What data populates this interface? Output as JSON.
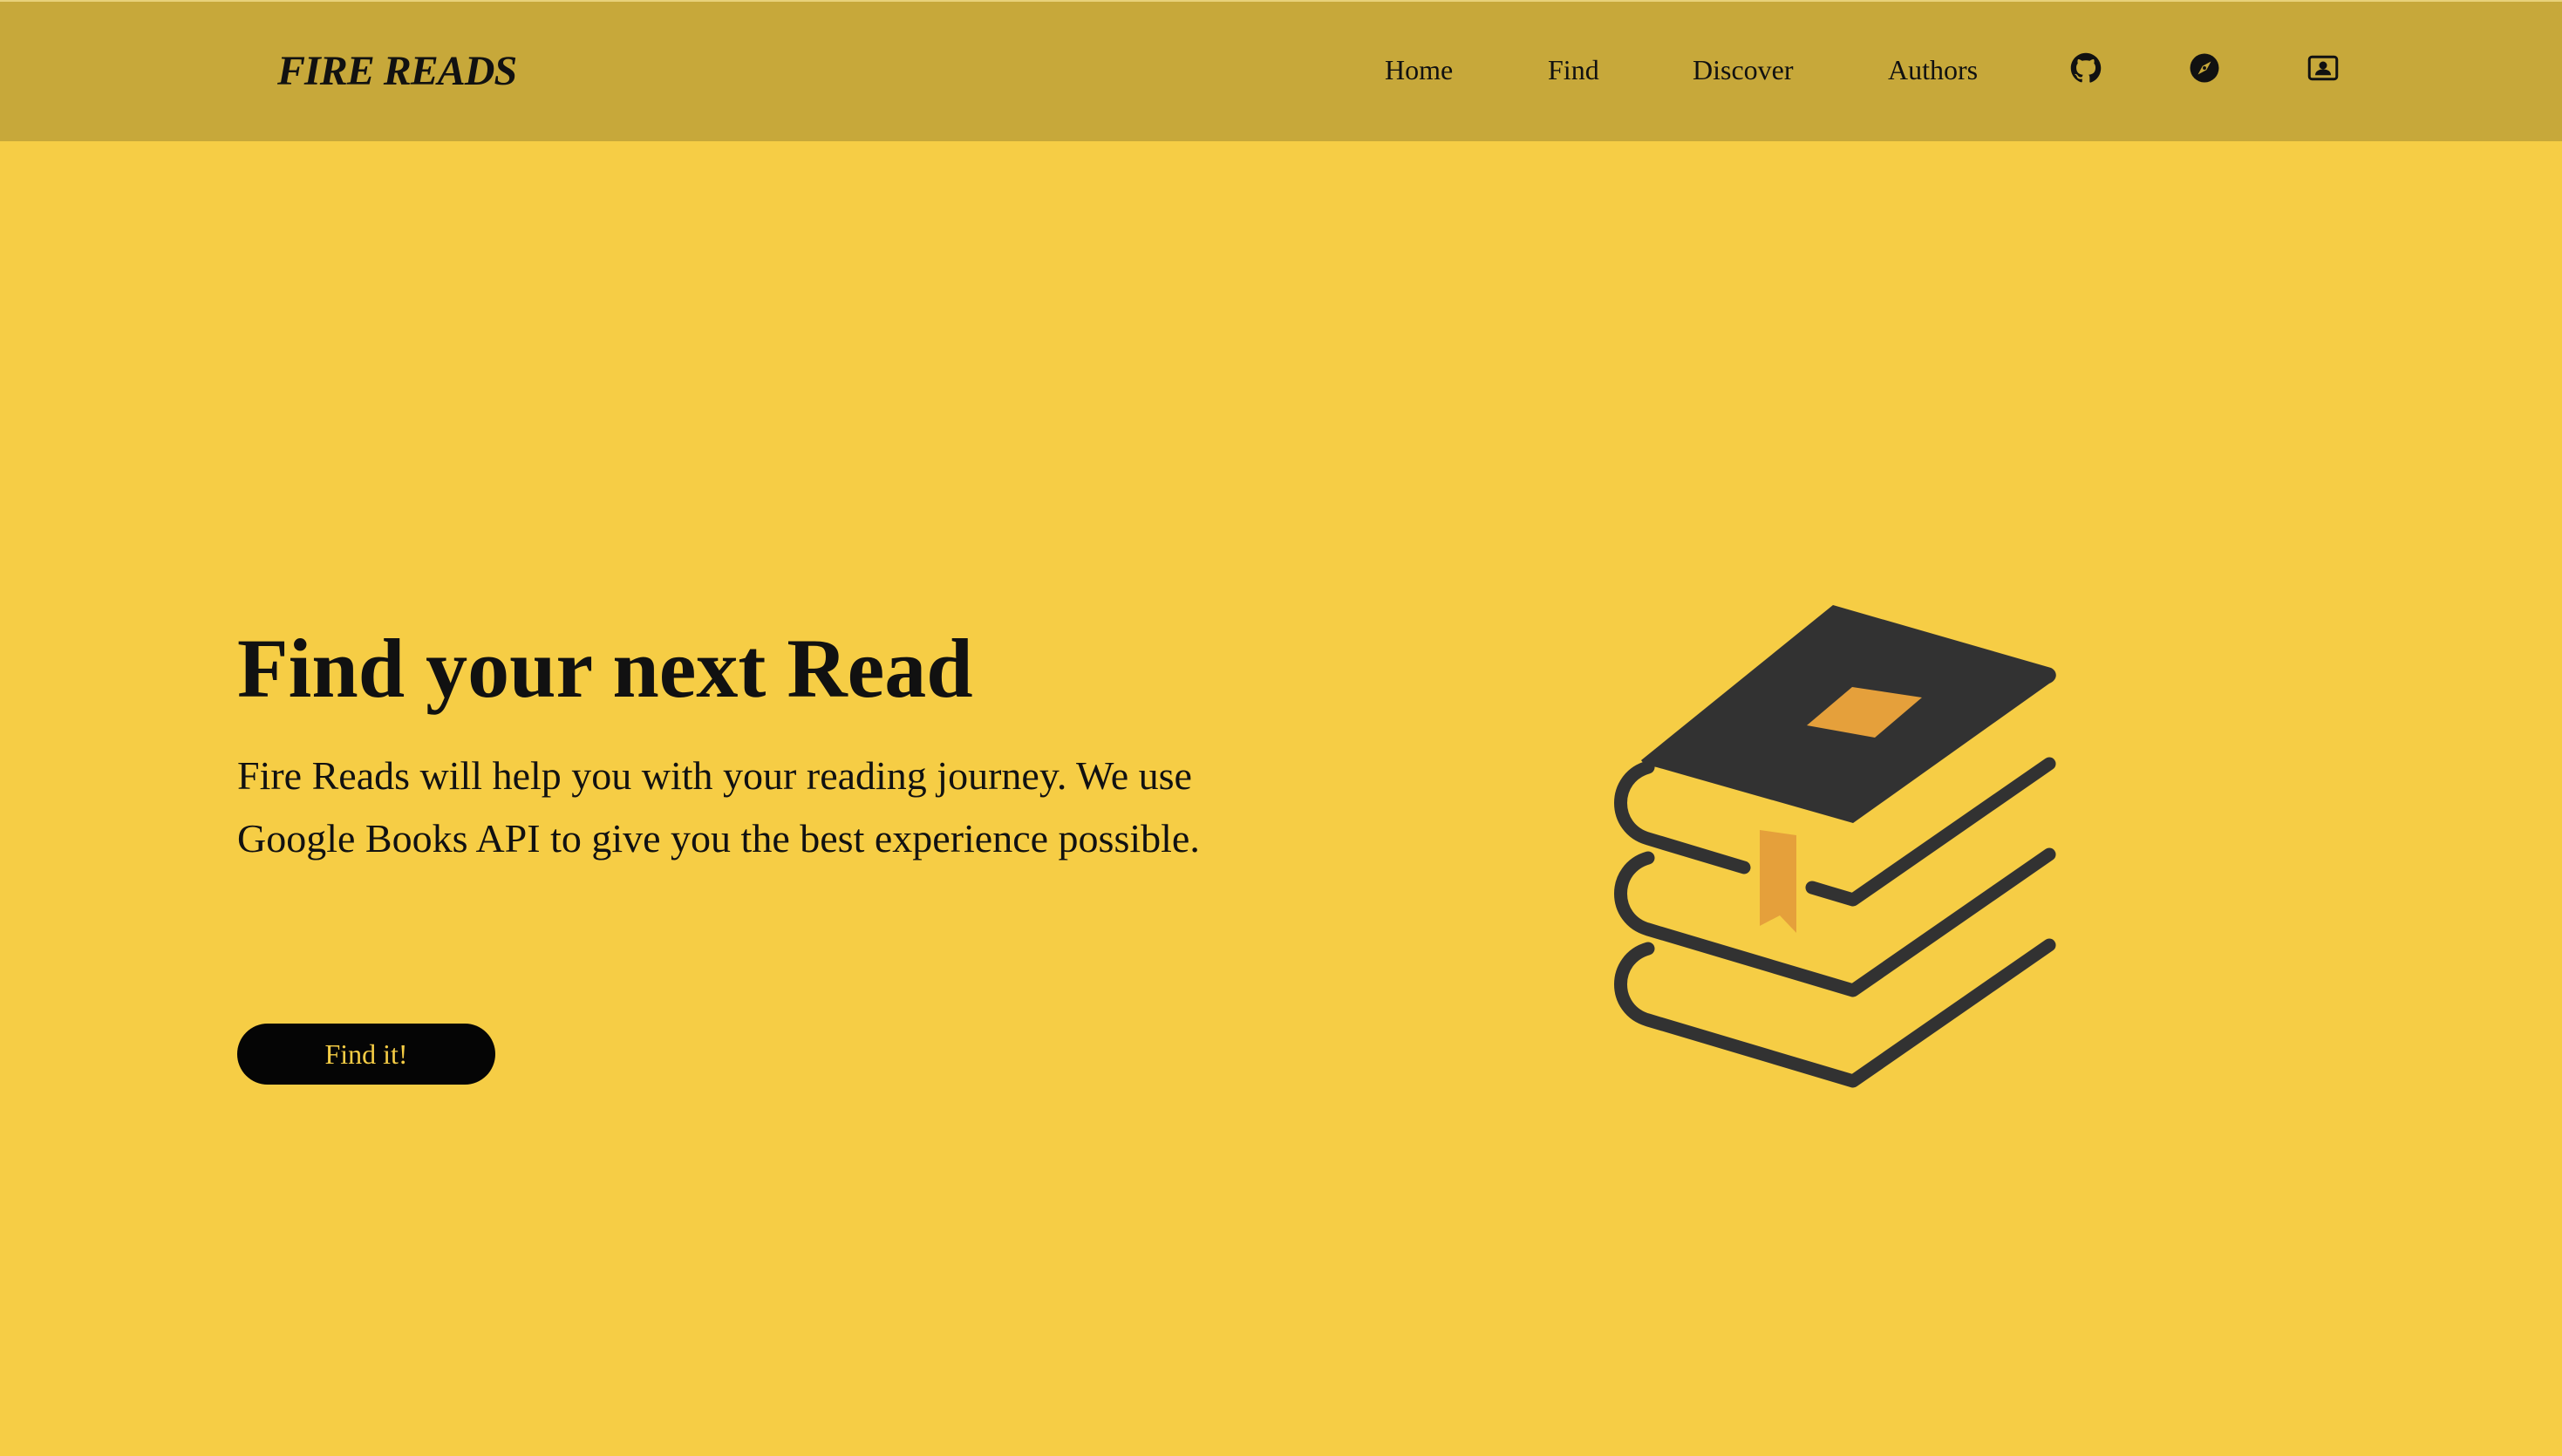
{
  "header": {
    "brand": "FIRE READS",
    "nav": {
      "home": "Home",
      "find": "Find",
      "discover": "Discover",
      "authors": "Authors"
    },
    "icons": [
      "github-icon",
      "compass-icon",
      "contact-card-icon"
    ]
  },
  "hero": {
    "title": "Find your next Read",
    "description": "Fire Reads will help you with your reading journey. We use Google Books API to give you the best experience possible.",
    "button_label": "Find it!",
    "illustration": "book-stack-icon"
  },
  "colors": {
    "background": "#F6CD45",
    "header": "#C7A83A",
    "button": "#050505",
    "button_text": "#F6CD45",
    "book": "#323232",
    "accent": "#E5A03B"
  }
}
